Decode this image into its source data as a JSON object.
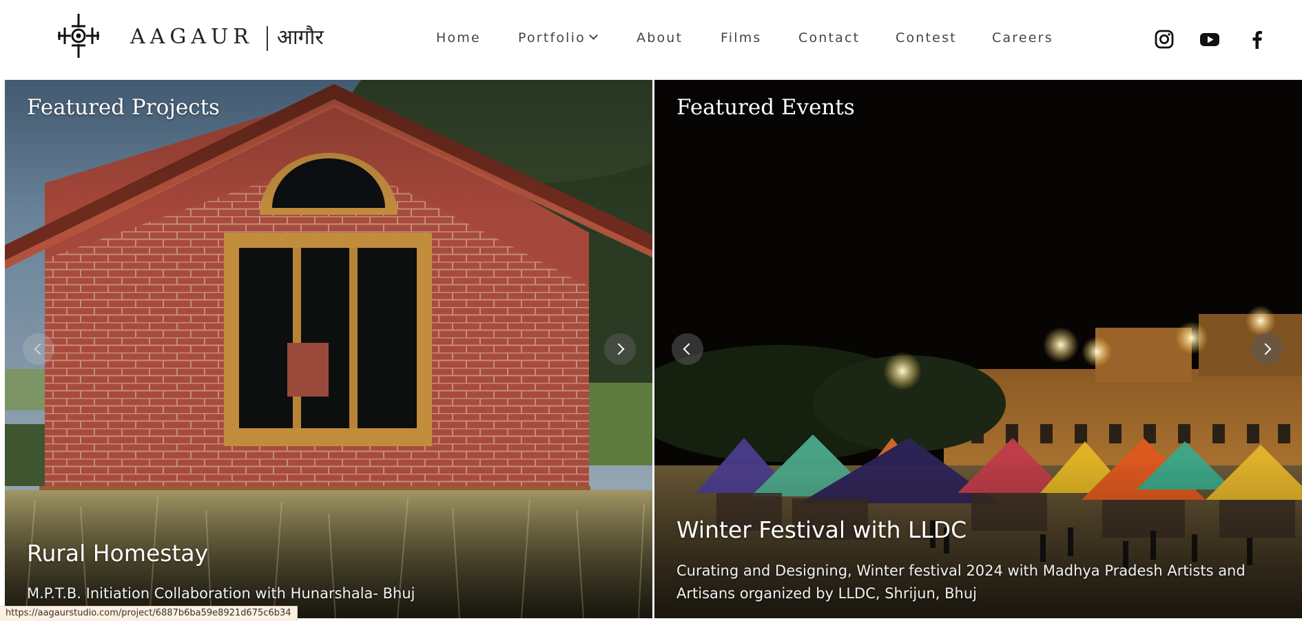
{
  "brand": {
    "name": "AAGAUR",
    "name_hindi": "आगौर"
  },
  "nav": {
    "items": [
      "Home",
      "Portfolio",
      "About",
      "Films",
      "Contact",
      "Contest",
      "Careers"
    ]
  },
  "social": {
    "icons": [
      "instagram-icon",
      "youtube-icon",
      "facebook-icon"
    ]
  },
  "featured_projects": {
    "heading": "Featured Projects",
    "title": "Rural Homestay",
    "description": "M.P.T.B. Initiation Collaboration with Hunarshala- Bhuj"
  },
  "featured_events": {
    "heading": "Featured Events",
    "title": "Winter Festival with LLDC",
    "description": "Curating and Designing, Winter festival 2024 with Madhya Pradesh Artists and Artisans organized by LLDC, Shrijun, Bhuj"
  },
  "status_bar": {
    "url": "https://aagaurstudio.com/project/6887b6ba59e8921d675c6b34"
  },
  "colors": {
    "brick": "#a5473a",
    "text_dark": "#222222",
    "night_sky": "#070504"
  }
}
